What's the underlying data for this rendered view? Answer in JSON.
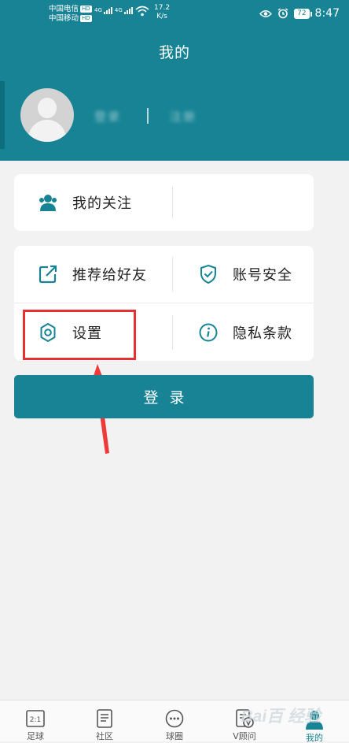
{
  "colors": {
    "brand": "#178394",
    "highlight": "#e83030",
    "background": "#f2f2f2"
  },
  "status_bar": {
    "carrier1": "中国电信",
    "carrier2": "中国移动",
    "net_tag": "HD",
    "signal_tag": "4G",
    "speed_value": "17.2",
    "speed_unit": "K/s",
    "battery": "72",
    "time": "8:47",
    "icons": [
      "eye-icon",
      "alarm-icon",
      "wifi-icon",
      "signal-icon",
      "battery-icon"
    ]
  },
  "header": {
    "title": "我的",
    "login_link": "登录",
    "register_link": "注册"
  },
  "menu": {
    "my_follow": {
      "label": "我的关注",
      "icon": "users-icon"
    },
    "recommend": {
      "label": "推荐给好友",
      "icon": "share-icon"
    },
    "account_security": {
      "label": "账号安全",
      "icon": "shield-check-icon"
    },
    "settings": {
      "label": "设置",
      "icon": "gear-icon"
    },
    "privacy": {
      "label": "隐私条款",
      "icon": "info-icon"
    }
  },
  "login_button": "登录",
  "tabbar": {
    "tabs": [
      {
        "label": "足球",
        "icon": "scoreboard-icon",
        "icon_text": "2:1"
      },
      {
        "label": "社区",
        "icon": "document-icon"
      },
      {
        "label": "球圈",
        "icon": "chat-bubble-icon"
      },
      {
        "label": "V顾问",
        "icon": "advisor-icon"
      },
      {
        "label": "我的",
        "icon": "profile-icon",
        "active": true
      }
    ]
  },
  "watermark": "Bai百 经验"
}
